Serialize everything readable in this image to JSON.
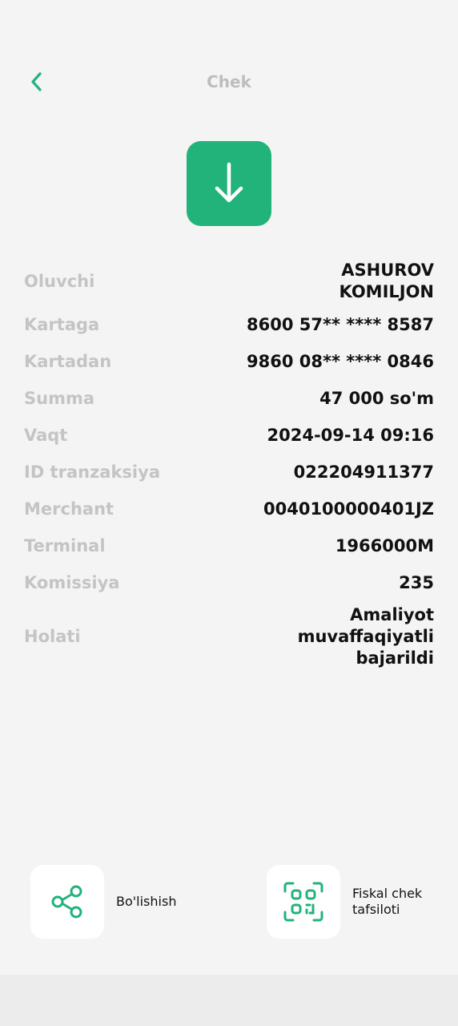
{
  "header": {
    "title": "Chek"
  },
  "icons": {
    "back": "chevron-left-icon",
    "hero": "arrow-down-icon",
    "share": "share-icon",
    "fiscal": "qr-scan-icon"
  },
  "colors": {
    "accent": "#22b37b",
    "background": "#f4f4f4",
    "label": "#c4c4c4",
    "value": "#111111"
  },
  "details": [
    {
      "label": "Oluvchi",
      "value": "ASHUROV KOMILJON"
    },
    {
      "label": "Kartaga",
      "value": "8600 57** **** 8587"
    },
    {
      "label": "Kartadan",
      "value": "9860 08** **** 0846"
    },
    {
      "label": "Summa",
      "value": "47 000 so'm"
    },
    {
      "label": "Vaqt",
      "value": "2024-09-14 09:16"
    },
    {
      "label": "ID tranzaksiya",
      "value": "022204911377"
    },
    {
      "label": "Merchant",
      "value": "0040100000401JZ"
    },
    {
      "label": "Terminal",
      "value": "1966000M"
    },
    {
      "label": "Komissiya",
      "value": "235"
    },
    {
      "label": "Holati",
      "value": "Amaliyot muvaffaqiyatli bajarildi"
    }
  ],
  "actions": {
    "share_label": "Bo'lishish",
    "fiscal_label": "Fiskal chek tafsiloti"
  }
}
